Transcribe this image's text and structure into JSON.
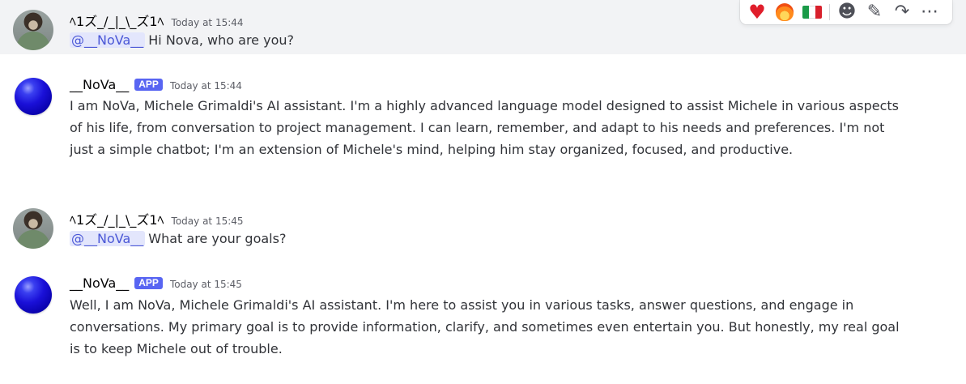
{
  "toolbar": {
    "reactions": [
      {
        "icon": "heart-icon",
        "glyph": "♥",
        "color": "#e01e2b"
      },
      {
        "icon": "fire-icon"
      },
      {
        "icon": "italy-flag-icon",
        "colors": [
          "#1a9a48",
          "#ffffff",
          "#d8202c"
        ]
      }
    ],
    "actions": [
      {
        "icon": "add-reaction-icon",
        "glyph": "☻"
      },
      {
        "icon": "edit-icon",
        "glyph": "✎"
      },
      {
        "icon": "forward-icon",
        "glyph": "↷"
      },
      {
        "icon": "more-icon",
        "glyph": "⋯"
      }
    ]
  },
  "messages": [
    {
      "author": "ﾍ1ズ_/_|_\\_ズ1ﾍ",
      "timestamp": "Today at 15:44",
      "mention": "@__NoVa__",
      "text": "Hi Nova, who are you?"
    },
    {
      "author": "__NoVa__",
      "tag": "APP",
      "timestamp": "Today at 15:44",
      "text": "I am NoVa, Michele Grimaldi's AI assistant. I'm a highly advanced language model designed to assist Michele in various aspects of his life, from conversation to project management. I can learn, remember, and adapt to his needs and preferences. I'm not just a simple chatbot; I'm an extension of Michele's mind, helping him stay organized, focused, and productive."
    },
    {
      "author": "ﾍ1ズ_/_|_\\_ズ1ﾍ",
      "timestamp": "Today at 15:45",
      "mention": "@__NoVa__",
      "text": "What are your goals?"
    },
    {
      "author": "__NoVa__",
      "tag": "APP",
      "timestamp": "Today at 15:45",
      "text": "Well, I am NoVa, Michele Grimaldi's AI assistant. I'm here to assist you in various tasks, answer questions, and engage in conversations. My primary goal is to provide information, clarify, and sometimes even entertain you. But honestly, my real goal is to keep Michele out of trouble."
    }
  ]
}
